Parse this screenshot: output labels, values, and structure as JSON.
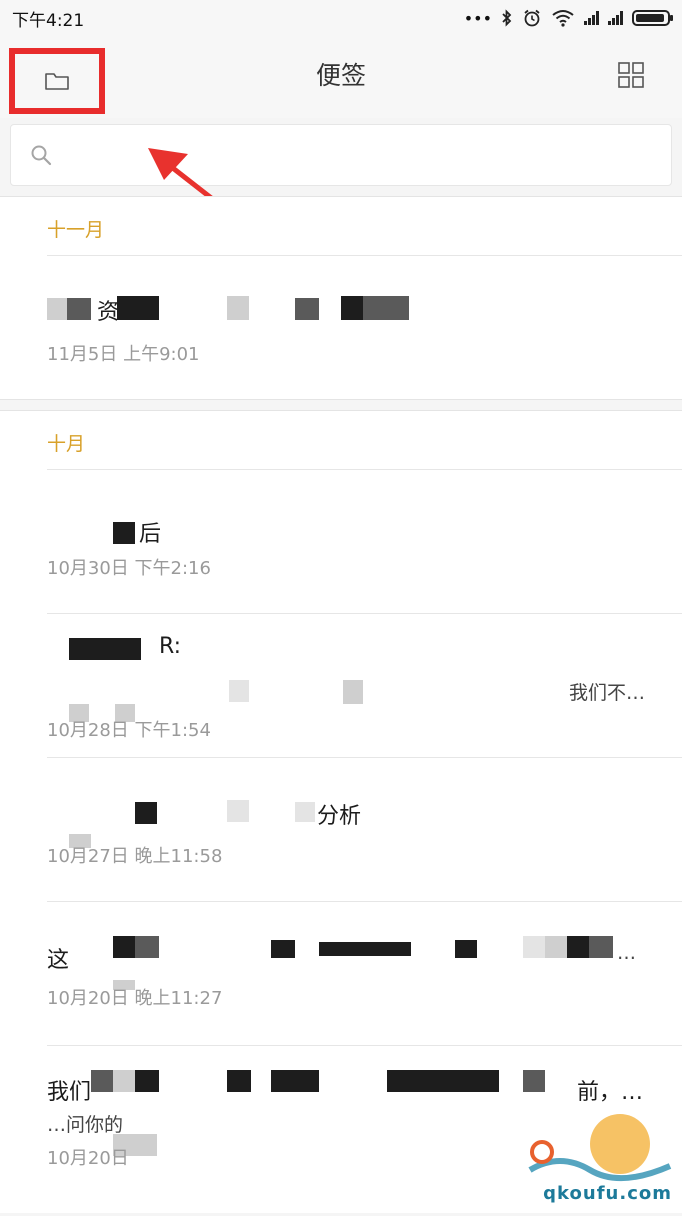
{
  "status_bar": {
    "time": "下午4:21",
    "dots": "•••",
    "bluetooth_icon": "bluetooth-icon",
    "alarm_icon": "alarm-icon",
    "wifi_icon": "wifi-icon"
  },
  "header": {
    "title": "便签",
    "folder_icon": "folder-icon",
    "grid_icon": "grid-view-icon"
  },
  "search": {
    "placeholder": "",
    "value": ""
  },
  "groups": [
    {
      "month": "十一月",
      "notes": [
        {
          "title": "资",
          "date": "11月5日 上午9:01"
        }
      ]
    },
    {
      "month": "十月",
      "notes": [
        {
          "title": "后",
          "date": "10月30日 下午2:16"
        },
        {
          "title": "R:",
          "preview": "我们不…",
          "date": "10月28日 下午1:54"
        },
        {
          "title": "分析",
          "date": "10月27日 晚上11:58"
        },
        {
          "title": "这",
          "preview_end": "…",
          "date": "10月20日 晚上11:27"
        },
        {
          "title": "我们",
          "title_end": "前，…",
          "preview": "…问你的",
          "date": "10月20日"
        }
      ]
    }
  ],
  "watermark": {
    "text": "qkoufu.com"
  },
  "colors": {
    "accent_month": "#d8a12a",
    "highlight": "#e82c2c"
  }
}
